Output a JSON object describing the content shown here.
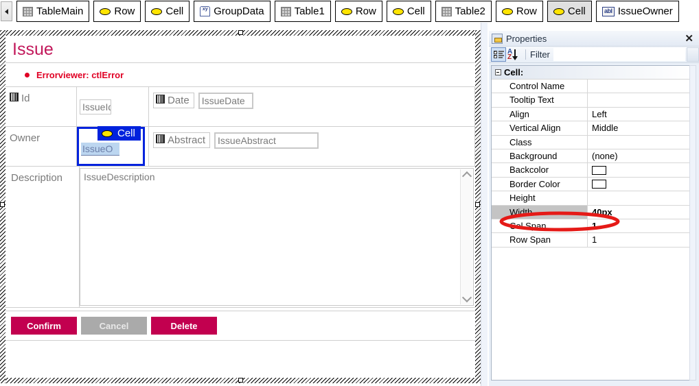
{
  "breadcrumb": {
    "scroll_left_icon": "triangle-left-icon",
    "items": [
      {
        "label": "TableMain",
        "icon": "grid-table-icon",
        "selected": false
      },
      {
        "label": "Row",
        "icon": "yellow-oval-icon",
        "selected": false
      },
      {
        "label": "Cell",
        "icon": "yellow-oval-icon",
        "selected": false
      },
      {
        "label": "GroupData",
        "icon": "xy-group-icon",
        "selected": false
      },
      {
        "label": "Table1",
        "icon": "grid-table-icon",
        "selected": false
      },
      {
        "label": "Row",
        "icon": "yellow-oval-icon",
        "selected": false
      },
      {
        "label": "Cell",
        "icon": "yellow-oval-icon",
        "selected": false
      },
      {
        "label": "Table2",
        "icon": "grid-table-icon",
        "selected": false
      },
      {
        "label": "Row",
        "icon": "yellow-oval-icon",
        "selected": false
      },
      {
        "label": "Cell",
        "icon": "yellow-oval-icon",
        "selected": true
      },
      {
        "label": "IssueOwner",
        "icon": "abl-textbox-icon",
        "selected": false
      }
    ]
  },
  "form": {
    "title": "Issue",
    "error_viewer": "Errorviewer: ctlError",
    "fields": {
      "id_label": "Id",
      "id_value": "IssueId",
      "date_label": "Date",
      "date_value": "IssueDate",
      "owner_label": "Owner",
      "owner_value": "IssueO",
      "abstract_label": "Abstract",
      "abstract_value": "IssueAbstract",
      "description_label": "Description",
      "description_value": "IssueDescription"
    },
    "selection_badge": {
      "label": "Cell",
      "icon": "yellow-oval-icon"
    },
    "buttons": [
      {
        "label": "Confirm",
        "style": "primary"
      },
      {
        "label": "Cancel",
        "style": "muted"
      },
      {
        "label": "Delete",
        "style": "primary"
      }
    ]
  },
  "properties": {
    "title": "Properties",
    "close_icon": "close-icon",
    "toolbar": {
      "categorized_icon": "categorized-view-icon",
      "sort_icon": "sort-alphabetical-icon",
      "filter_label": "Filter",
      "filter_value": "",
      "filter_placeholder": "",
      "dropdown_icon": "chevron-down-icon"
    },
    "category": "Cell:",
    "rows": [
      {
        "name": "Control Name",
        "value": "",
        "type": "text",
        "bold": false,
        "selected": false
      },
      {
        "name": "Tooltip Text",
        "value": "",
        "type": "text",
        "bold": false,
        "selected": false
      },
      {
        "name": "Align",
        "value": "Left",
        "type": "text",
        "bold": false,
        "selected": false
      },
      {
        "name": "Vertical Align",
        "value": "Middle",
        "type": "text",
        "bold": false,
        "selected": false
      },
      {
        "name": "Class",
        "value": "",
        "type": "text",
        "bold": false,
        "selected": false
      },
      {
        "name": "Background",
        "value": "(none)",
        "type": "text",
        "bold": false,
        "selected": false
      },
      {
        "name": "Backcolor",
        "value": "",
        "type": "swatch",
        "bold": false,
        "selected": false
      },
      {
        "name": "Border Color",
        "value": "",
        "type": "swatch",
        "bold": false,
        "selected": false
      },
      {
        "name": "Height",
        "value": "",
        "type": "text",
        "bold": false,
        "selected": false
      },
      {
        "name": "Width",
        "value": "40px",
        "type": "text",
        "bold": true,
        "selected": true
      },
      {
        "name": "Col Span",
        "value": "1",
        "type": "text",
        "bold": true,
        "selected": false
      },
      {
        "name": "Row Span",
        "value": "1",
        "type": "text",
        "bold": false,
        "selected": false
      }
    ]
  },
  "annotation": {
    "shape": "red-ellipse",
    "color": "#e51a17",
    "targets": "Width"
  },
  "colors": {
    "accent_crimson": "#c2004f",
    "title_crimson": "#c2185b",
    "error_red": "#e00024",
    "selection_blue": "#0022dd",
    "annotation_red": "#e51a17",
    "icon_yellow": "#ffe400"
  }
}
